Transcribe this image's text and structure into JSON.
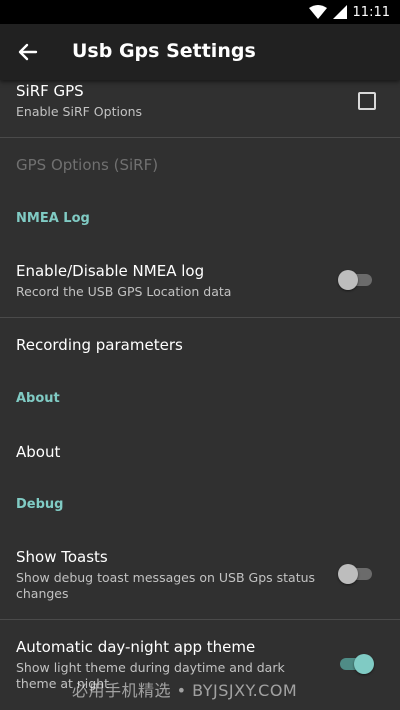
{
  "status_bar": {
    "time": "11:11",
    "wifi_icon": "wifi-icon",
    "battery_icon": "battery-icon"
  },
  "toolbar": {
    "title": "Usb Gps Settings",
    "back_icon": "arrow-back-icon"
  },
  "prefs": {
    "sirf": {
      "title": "SiRF GPS",
      "summary": "Enable SiRF Options",
      "checked": false
    },
    "gps_options": {
      "title": "GPS Options (SiRF)"
    },
    "nmea_category": "NMEA Log",
    "nmea_log": {
      "title": "Enable/Disable NMEA log",
      "summary": "Record the USB GPS Location data",
      "enabled": false
    },
    "recording": {
      "title": "Recording parameters"
    },
    "about_category": "About",
    "about": {
      "title": "About"
    },
    "debug_category": "Debug",
    "show_toasts": {
      "title": "Show Toasts",
      "summary": "Show debug toast messages on USB Gps status changes",
      "enabled": false
    },
    "day_night": {
      "title": "Automatic day-night app theme",
      "summary": "Show light theme during daytime and dark theme at night",
      "enabled": true
    }
  },
  "watermark": "必用手机精选 • BYJSJXY.COM",
  "colors": {
    "accent": "#80cbc4",
    "background": "#303030",
    "toolbar": "#212121"
  }
}
